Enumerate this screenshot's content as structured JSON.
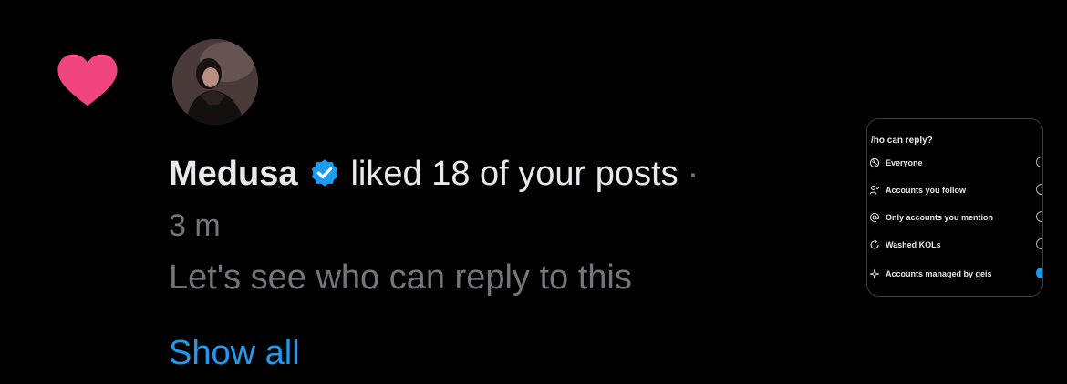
{
  "notification": {
    "icon": "heart-icon",
    "icon_color": "#f0457f",
    "user": {
      "name": "Medusa",
      "verified": true,
      "verified_color": "#1d9bf0"
    },
    "action_text": "liked 18 of your posts",
    "separator": "·",
    "time": "3 m",
    "post_preview": "Let's see who can reply to this",
    "show_all_label": "Show all"
  },
  "thumbnail": {
    "title": "/ho can reply?",
    "options": [
      {
        "icon": "globe-icon",
        "label": "Everyone",
        "selected": false
      },
      {
        "icon": "person-check-icon",
        "label": "Accounts you follow",
        "selected": false
      },
      {
        "icon": "at-sign-icon",
        "label": "Only accounts you mention",
        "selected": false
      },
      {
        "icon": "refresh-icon",
        "label": "Washed KOLs",
        "selected": false
      },
      {
        "icon": "sparkle-icon",
        "label": "Accounts managed by geis",
        "selected": true
      }
    ]
  },
  "colors": {
    "background": "#000000",
    "text_primary": "#e7e9ea",
    "text_secondary": "#71767b",
    "link": "#1d9bf0"
  }
}
